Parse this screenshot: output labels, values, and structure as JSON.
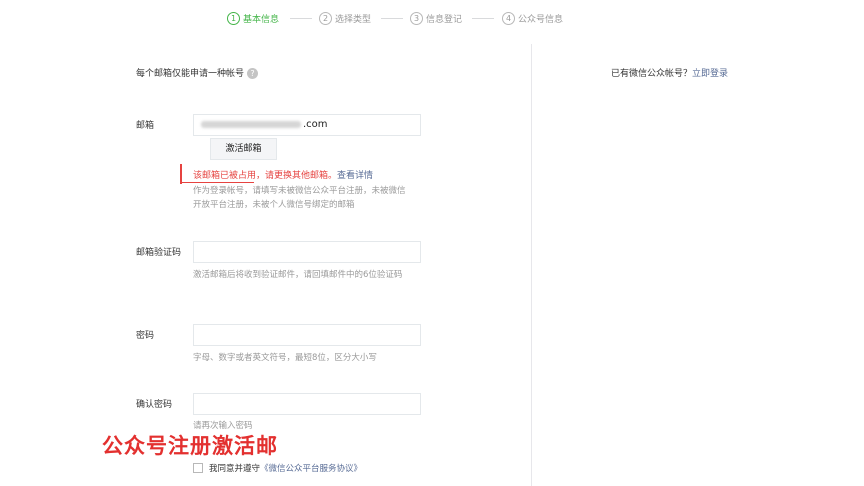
{
  "stepper": {
    "steps": [
      {
        "num": "1",
        "label": "基本信息"
      },
      {
        "num": "2",
        "label": "选择类型"
      },
      {
        "num": "3",
        "label": "信息登记"
      },
      {
        "num": "4",
        "label": "公众号信息"
      }
    ]
  },
  "form": {
    "intro": "每个邮箱仅能申请一种帐号",
    "help_icon": "?",
    "email": {
      "label": "邮箱",
      "value_suffix": ".com",
      "activate_button": "激活邮箱",
      "error": "该邮箱已被占用，请更换其他邮箱。",
      "error_link": "查看详情",
      "hint": "作为登录帐号，请填写未被微信公众平台注册，未被微信开放平台注册，未被个人微信号绑定的邮箱"
    },
    "code": {
      "label": "邮箱验证码",
      "value": "",
      "hint": "激活邮箱后将收到验证邮件，请回填邮件中的6位验证码"
    },
    "password": {
      "label": "密码",
      "value": "",
      "hint": "字母、数字或者英文符号，最短8位，区分大小写"
    },
    "confirm": {
      "label": "确认密码",
      "value": "",
      "hint": "请再次输入密码"
    },
    "agreement": {
      "prefix": "我同意并遵守",
      "link": "《微信公众平台服务协议》"
    }
  },
  "sidebar": {
    "has_account": "已有微信公众帐号？",
    "login_link": "立即登录"
  },
  "watermark": "公众号注册激活邮",
  "colors": {
    "accent": "#44b549",
    "error": "#e64340",
    "link": "#576b95"
  }
}
